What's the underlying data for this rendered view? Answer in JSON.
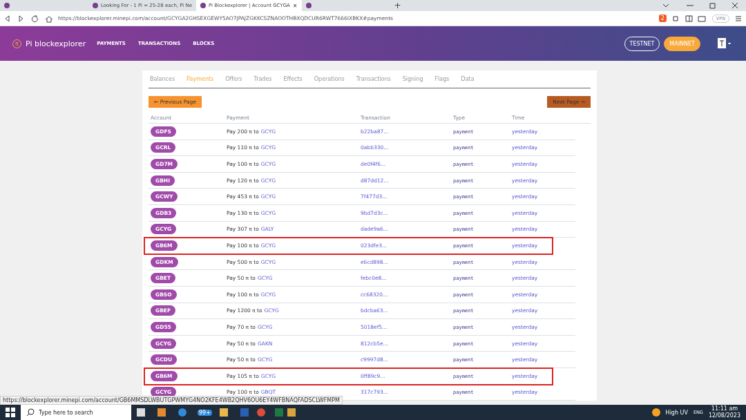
{
  "browser": {
    "tabs": [
      {
        "selected": false
      },
      {
        "title": "Looking For - 1 Pi = 25-28 each, Pi Ne",
        "selected": false
      },
      {
        "title": "Pi Blockexplorer | Account GCYGA",
        "selected": true
      },
      {
        "selected": false
      }
    ],
    "new_tab": "+",
    "tab_close": "✕",
    "url": "https://blockexplorer.minepi.com/account/GCYGA2GHSEXGEWY5AO7JPAJZGKKCSZNAOOTHBXQDCUR6RWT7666IXBKX#payments",
    "vpn": "VPN",
    "shield_count": "2",
    "status_url": "https://blockexplorer.minepi.com/account/GB6MMSDLWBUTGPWMYG4NO2KFE4WB2QHV6OU6EY4WFBNAQFADSCLWFMPM"
  },
  "site": {
    "logo_symbol": "π",
    "logo_pi": "Pi",
    "logo_text": "blockexplorer",
    "nav": [
      "PAYMENTS",
      "TRANSACTIONS",
      "BLOCKS"
    ],
    "networks": [
      {
        "label": "TESTNET",
        "selected": false
      },
      {
        "label": "MAINNET",
        "selected": true
      }
    ]
  },
  "account_tabs": [
    {
      "label": "Balances",
      "selected": false
    },
    {
      "label": "Payments",
      "selected": true
    },
    {
      "label": "Offers",
      "selected": false
    },
    {
      "label": "Trades",
      "selected": false
    },
    {
      "label": "Effects",
      "selected": false
    },
    {
      "label": "Operations",
      "selected": false
    },
    {
      "label": "Transactions",
      "selected": false
    },
    {
      "label": "Signing",
      "selected": false
    },
    {
      "label": "Flags",
      "selected": false
    },
    {
      "label": "Data",
      "selected": false
    }
  ],
  "pager": {
    "previous": "← Previous Page",
    "next": "Next Page →"
  },
  "table": {
    "columns": [
      "Account",
      "Payment",
      "Transaction",
      "Type",
      "Time"
    ],
    "rows": [
      {
        "account": "GDFS",
        "pay": "Pay 200 π to",
        "to": "GCYG",
        "tx": "b22ba87...",
        "type": "payment",
        "time": "yesterday",
        "highlighted": false
      },
      {
        "account": "GCRL",
        "pay": "Pay 110 π to",
        "to": "GCYG",
        "tx": "0abb330...",
        "type": "payment",
        "time": "yesterday",
        "highlighted": false
      },
      {
        "account": "GD7M",
        "pay": "Pay 100 π to",
        "to": "GCYG",
        "tx": "de0f4f6...",
        "type": "payment",
        "time": "yesterday",
        "highlighted": false
      },
      {
        "account": "GBHI",
        "pay": "Pay 120 π to",
        "to": "GCYG",
        "tx": "d87dd12...",
        "type": "payment",
        "time": "yesterday",
        "highlighted": false
      },
      {
        "account": "GCWY",
        "pay": "Pay 453 π to",
        "to": "GCYG",
        "tx": "7f477d3...",
        "type": "payment",
        "time": "yesterday",
        "highlighted": false
      },
      {
        "account": "GDB3",
        "pay": "Pay 130 π to",
        "to": "GCYG",
        "tx": "9bd7d3c...",
        "type": "payment",
        "time": "yesterday",
        "highlighted": false
      },
      {
        "account": "GCYG",
        "pay": "Pay 307 π to",
        "to": "GALY",
        "tx": "dade9a6...",
        "type": "payment",
        "time": "yesterday",
        "highlighted": false
      },
      {
        "account": "GB6M",
        "pay": "Pay 100 π to",
        "to": "GCYG",
        "tx": "023dfe3...",
        "type": "payment",
        "time": "yesterday",
        "highlighted": true
      },
      {
        "account": "GDKM",
        "pay": "Pay 500 π to",
        "to": "GCYG",
        "tx": "e6cd898...",
        "type": "payment",
        "time": "yesterday",
        "highlighted": false
      },
      {
        "account": "GBET",
        "pay": "Pay 50 π to",
        "to": "GCYG",
        "tx": "febc0e8...",
        "type": "payment",
        "time": "yesterday",
        "highlighted": false
      },
      {
        "account": "GBSO",
        "pay": "Pay 100 π to",
        "to": "GCYG",
        "tx": "cc68320...",
        "type": "payment",
        "time": "yesterday",
        "highlighted": false
      },
      {
        "account": "GBEF",
        "pay": "Pay 1200 π to",
        "to": "GCYG",
        "tx": "bdcba63...",
        "type": "payment",
        "time": "yesterday",
        "highlighted": false
      },
      {
        "account": "GD55",
        "pay": "Pay 70 π to",
        "to": "GCYG",
        "tx": "5018ef5...",
        "type": "payment",
        "time": "yesterday",
        "highlighted": false
      },
      {
        "account": "GCYG",
        "pay": "Pay 50 π to",
        "to": "GAKN",
        "tx": "812cb5e...",
        "type": "payment",
        "time": "yesterday",
        "highlighted": false
      },
      {
        "account": "GCDU",
        "pay": "Pay 50 π to",
        "to": "GCYG",
        "tx": "c9997d8...",
        "type": "payment",
        "time": "yesterday",
        "highlighted": false
      },
      {
        "account": "GB6M",
        "pay": "Pay 105 π to",
        "to": "GCYG",
        "tx": "0ff89c9...",
        "type": "payment",
        "time": "yesterday",
        "highlighted": true
      },
      {
        "account": "GCYG",
        "pay": "Pay 100 π to",
        "to": "GBQT",
        "tx": "317c793...",
        "type": "payment",
        "time": "yesterday",
        "highlighted": false
      }
    ]
  },
  "taskbar": {
    "search_placeholder": "Type here to search",
    "mail_badge": "99+",
    "weather": "High UV",
    "language": "ENG",
    "time": "11:11 am",
    "date": "12/08/2023"
  }
}
